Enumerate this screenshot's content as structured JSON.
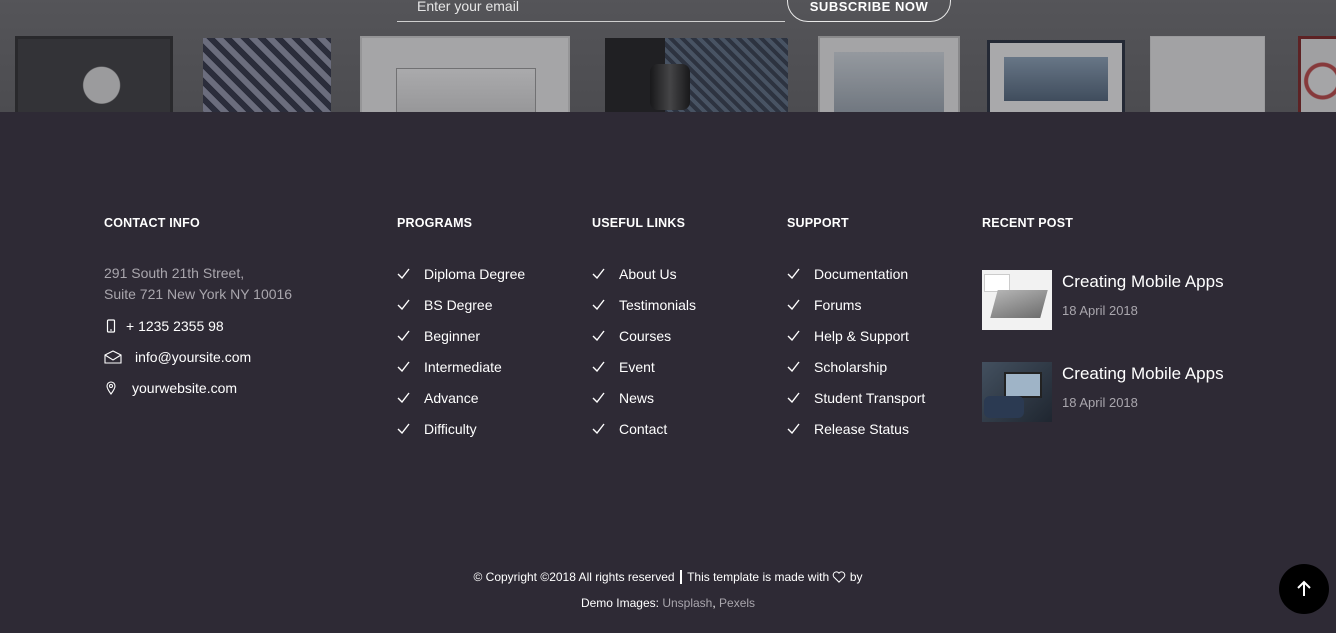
{
  "newsletter": {
    "email_placeholder": "Enter your email",
    "subscribe_label": "SUBSCRIBE NOW"
  },
  "contact": {
    "heading": "CONTACT INFO",
    "address_line1": "291 South 21th Street,",
    "address_line2": "Suite 721 New York NY 10016",
    "phone": "+ 1235 2355 98",
    "email": "info@yoursite.com",
    "website": "yourwebsite.com"
  },
  "programs": {
    "heading": "PROGRAMS",
    "items": [
      "Diploma Degree",
      "BS Degree",
      "Beginner",
      "Intermediate",
      "Advance",
      "Difficulty"
    ]
  },
  "useful_links": {
    "heading": "USEFUL LINKS",
    "items": [
      "About Us",
      "Testimonials",
      "Courses",
      "Event",
      "News",
      "Contact"
    ]
  },
  "support": {
    "heading": "SUPPORT",
    "items": [
      "Documentation",
      "Forums",
      "Help & Support",
      "Scholarship",
      "Student Transport",
      "Release Status"
    ]
  },
  "recent_post": {
    "heading": "RECENT POST",
    "posts": [
      {
        "title": "Creating Mobile Apps",
        "date": "18 April 2018"
      },
      {
        "title": "Creating Mobile Apps",
        "date": "18 April 2018"
      }
    ]
  },
  "copyright": {
    "text_left": "© Copyright ©2018 All rights reserved",
    "text_right": "This template is made with",
    "by": "by ",
    "demo_prefix": "Demo Images: ",
    "link1": "Unsplash",
    "sep": ", ",
    "link2": "Pexels"
  },
  "colors": {
    "footer_bg": "#2e2a35",
    "muted_text": "#a9a6ad",
    "white": "#ffffff"
  },
  "icons": {
    "phone": "mobile-phone-icon",
    "email": "envelope-icon",
    "website": "map-pin-icon",
    "check": "check-icon",
    "heart": "heart-icon",
    "back_to_top": "arrow-up-icon"
  }
}
